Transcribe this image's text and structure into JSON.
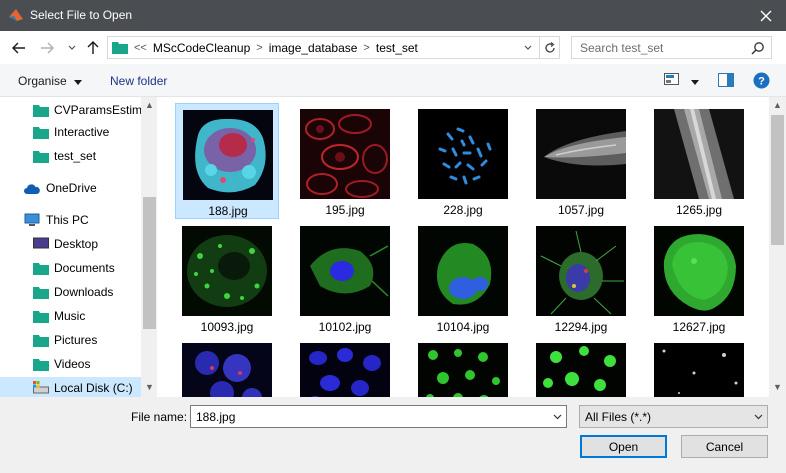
{
  "window": {
    "title": "Select File to Open"
  },
  "address": {
    "overflow": "<<",
    "crumbs": [
      "MScCodeCleanup",
      "image_database",
      "test_set"
    ]
  },
  "search": {
    "placeholder": "Search test_set"
  },
  "toolbar": {
    "organise": "Organise",
    "new_folder": "New folder"
  },
  "sidebar": {
    "items": [
      {
        "label": "CVParamsEstima",
        "icon": "folder-icon"
      },
      {
        "label": "Interactive",
        "icon": "folder-icon"
      },
      {
        "label": "test_set",
        "icon": "folder-icon"
      },
      {
        "label": "OneDrive",
        "icon": "cloud-icon"
      },
      {
        "label": "This PC",
        "icon": "computer-icon"
      },
      {
        "label": "Desktop",
        "icon": "desktop-icon"
      },
      {
        "label": "Documents",
        "icon": "folder-icon"
      },
      {
        "label": "Downloads",
        "icon": "folder-icon"
      },
      {
        "label": "Music",
        "icon": "folder-icon"
      },
      {
        "label": "Pictures",
        "icon": "folder-icon"
      },
      {
        "label": "Videos",
        "icon": "folder-icon"
      },
      {
        "label": "Local Disk (C:)",
        "icon": "disk-icon"
      }
    ]
  },
  "files": [
    {
      "name": "188.jpg",
      "style": "cell-cyan-red"
    },
    {
      "name": "195.jpg",
      "style": "red-tissue"
    },
    {
      "name": "228.jpg",
      "style": "blue-chromosomes"
    },
    {
      "name": "1057.jpg",
      "style": "gray-worm"
    },
    {
      "name": "1265.jpg",
      "style": "gray-fiber"
    },
    {
      "name": "10093.jpg",
      "style": "green-spots-cell"
    },
    {
      "name": "10102.jpg",
      "style": "green-blue-cell"
    },
    {
      "name": "10104.jpg",
      "style": "green-blue-cell-2"
    },
    {
      "name": "12294.jpg",
      "style": "green-fibrous"
    },
    {
      "name": "12627.jpg",
      "style": "green-round-cell"
    },
    {
      "name": "",
      "style": "blue-red-cluster"
    },
    {
      "name": "",
      "style": "blue-nuclei"
    },
    {
      "name": "",
      "style": "green-dots"
    },
    {
      "name": "",
      "style": "green-dots-2"
    },
    {
      "name": "",
      "style": "sparse-dots"
    }
  ],
  "bottom": {
    "file_name_label": "File name:",
    "file_name_value": "188.jpg",
    "file_type": "All Files (*.*)",
    "open": "Open",
    "cancel": "Cancel"
  },
  "colors": {
    "titlebar": "#4a4d51",
    "selection": "#cce8ff",
    "link": "#1e3287",
    "folder": "#1aa68a"
  }
}
